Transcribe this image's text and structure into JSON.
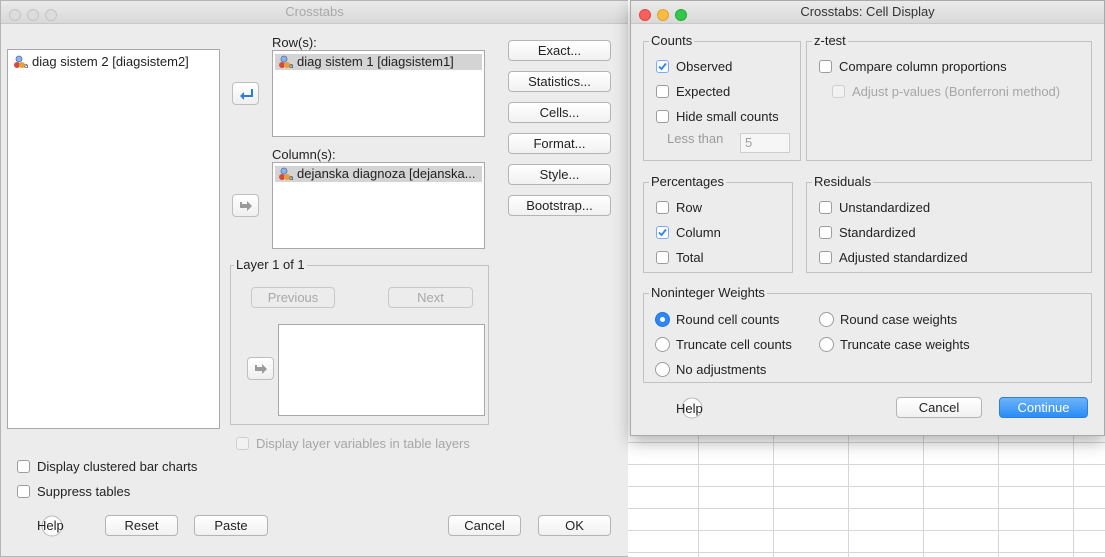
{
  "main": {
    "title": "Crosstabs",
    "source_items": [
      "diag sistem 2 [diagsistem2]"
    ],
    "rows_label": "Row(s):",
    "rows_items": [
      "diag sistem 1 [diagsistem1]"
    ],
    "columns_label": "Column(s):",
    "columns_items": [
      "dejanska diagnoza [dejanska..."
    ],
    "side_buttons": {
      "exact": "Exact...",
      "statistics": "Statistics...",
      "cells": "Cells...",
      "format": "Format...",
      "style": "Style...",
      "bootstrap": "Bootstrap..."
    },
    "layer_label": "Layer 1 of 1",
    "previous": "Previous",
    "next": "Next",
    "display_layer_vars": "Display layer variables in table layers",
    "clustered_bar": "Display clustered bar charts",
    "suppress_tables": "Suppress tables",
    "help": "Help",
    "reset": "Reset",
    "paste": "Paste",
    "cancel": "Cancel",
    "ok": "OK"
  },
  "cell_display": {
    "title": "Crosstabs: Cell Display",
    "counts": {
      "label": "Counts",
      "observed": "Observed",
      "observed_checked": true,
      "expected": "Expected",
      "hide_small": "Hide small counts",
      "less_than": "Less than",
      "less_than_value": "5"
    },
    "ztest": {
      "label": "z-test",
      "compare": "Compare column proportions",
      "adjust": "Adjust p-values (Bonferroni method)"
    },
    "percentages": {
      "label": "Percentages",
      "row": "Row",
      "column": "Column",
      "column_checked": true,
      "total": "Total"
    },
    "residuals": {
      "label": "Residuals",
      "unstandardized": "Unstandardized",
      "standardized": "Standardized",
      "adjusted": "Adjusted standardized"
    },
    "weights": {
      "label": "Noninteger Weights",
      "round_cell": "Round cell counts",
      "round_case": "Round case weights",
      "truncate_cell": "Truncate cell counts",
      "truncate_case": "Truncate case weights",
      "no_adjust": "No adjustments",
      "selected": "Round cell counts"
    },
    "help": "Help",
    "cancel": "Cancel",
    "continue": "Continue"
  },
  "colors": {
    "accent": "#2e87f7",
    "check": "#2f7ff5",
    "window_bg": "#ececec"
  }
}
